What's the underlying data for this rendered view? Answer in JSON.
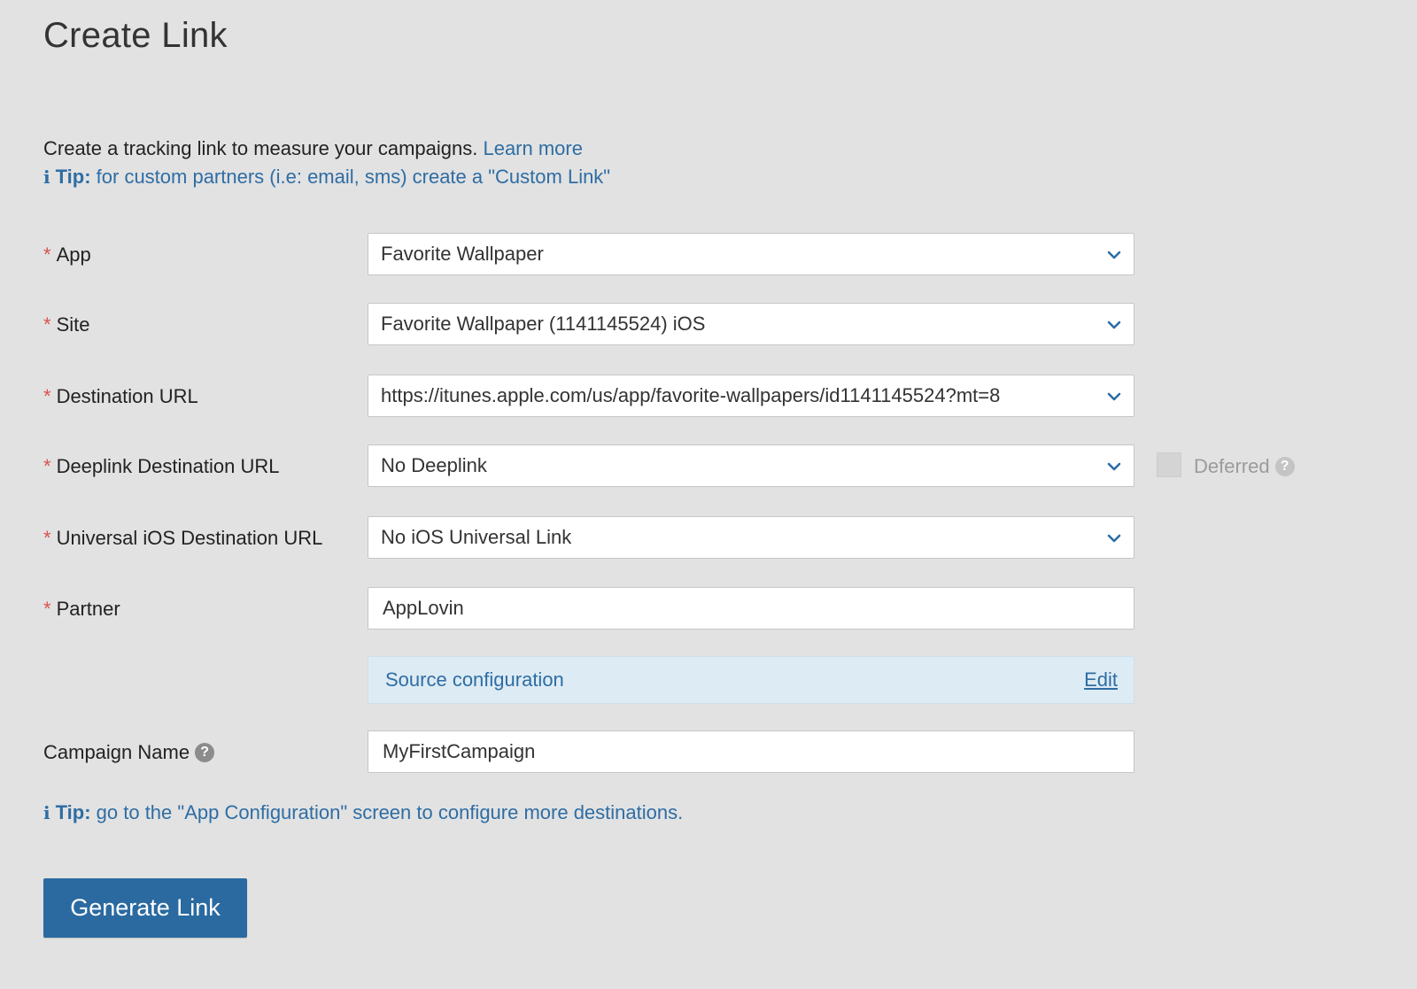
{
  "page": {
    "title": "Create Link"
  },
  "intro": {
    "text": "Create a tracking link to measure your campaigns.",
    "learn_more": "Learn more",
    "tip_label": "Tip:",
    "tip_text": "for custom partners (i.e: email, sms) create a \"Custom Link\""
  },
  "form": {
    "app": {
      "label": "App",
      "value": "Favorite Wallpaper",
      "required": "*"
    },
    "site": {
      "label": "Site",
      "value": "Favorite Wallpaper (1141145524) iOS",
      "required": "*"
    },
    "destination_url": {
      "label": "Destination URL",
      "value": "https://itunes.apple.com/us/app/favorite-wallpapers/id1141145524?mt=8",
      "required": "*"
    },
    "deeplink_url": {
      "label": "Deeplink Destination URL",
      "value": "No Deeplink",
      "required": "*"
    },
    "deferred": {
      "label": "Deferred",
      "checked": false
    },
    "universal_ios_url": {
      "label": "Universal iOS Destination URL",
      "value": "No iOS Universal Link",
      "required": "*"
    },
    "partner": {
      "label": "Partner",
      "value": "AppLovin",
      "required": "*"
    },
    "source_config": {
      "label": "Source configuration",
      "edit": "Edit"
    },
    "campaign_name": {
      "label": "Campaign Name",
      "value": "MyFirstCampaign"
    }
  },
  "tip2": {
    "label": "Tip:",
    "text": "go to the \"App Configuration\" screen to configure more destinations."
  },
  "actions": {
    "generate": "Generate Link"
  },
  "icons": {
    "info": "info-icon",
    "help": "help-icon",
    "chevron": "chevron-down-icon",
    "help_glyph": "?",
    "info_glyph": "i"
  },
  "colors": {
    "background": "#e2e2e2",
    "link": "#2e6da4",
    "required": "#d9534f",
    "button": "#2a6aa0",
    "source_bg": "#ddebf4"
  }
}
